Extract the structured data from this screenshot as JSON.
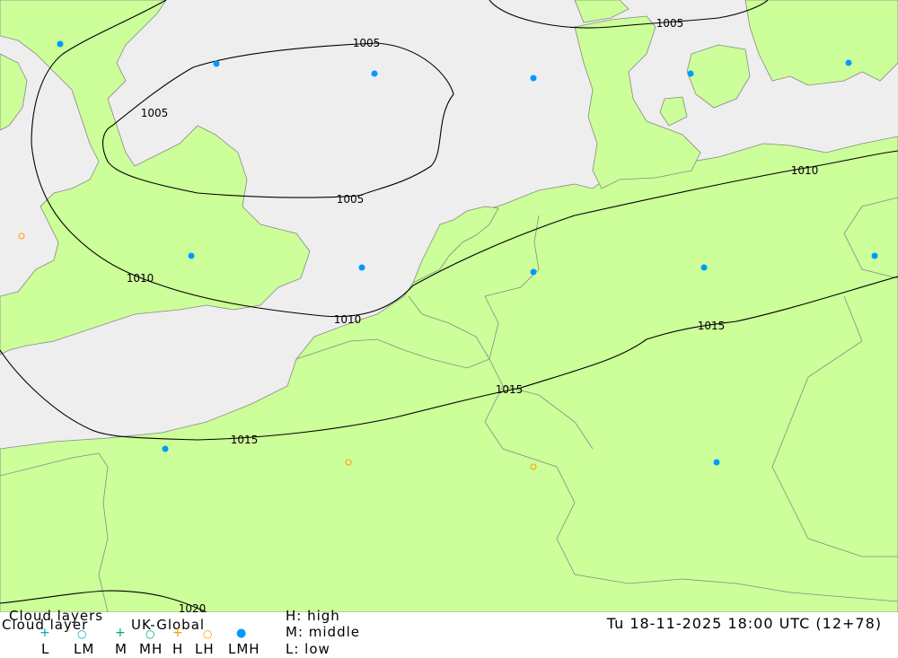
{
  "map": {
    "isobars": [
      {
        "label": "1005"
      },
      {
        "label": "1005"
      },
      {
        "label": "1005"
      },
      {
        "label": "1005"
      },
      {
        "label": "1010"
      },
      {
        "label": "1010"
      },
      {
        "label": "1010"
      },
      {
        "label": "1015"
      },
      {
        "label": "1015"
      },
      {
        "label": "1015"
      },
      {
        "label": "1020"
      }
    ],
    "colors": {
      "sea": "#eeeeee",
      "land": "#ccff99",
      "isobar": "#000000",
      "border": "#888888",
      "marker_filled": "#0099ff",
      "marker_ring": "#ff9900"
    }
  },
  "footer": {
    "title_line1": "Cloud layers",
    "title_line2": "Cloud layer",
    "model": "UK-Global",
    "legend_symbols": [
      {
        "label": "L",
        "icon": "plus",
        "color": "#00aacc"
      },
      {
        "label": "LM",
        "icon": "ring",
        "color": "#00aacc"
      },
      {
        "label": "M",
        "icon": "plus",
        "color": "#00aa66"
      },
      {
        "label": "MH",
        "icon": "ring",
        "color": "#00aa66"
      },
      {
        "label": "H",
        "icon": "plus",
        "color": "#ff9900"
      },
      {
        "label": "LH",
        "icon": "ring",
        "color": "#ff9900"
      },
      {
        "label": "LMH",
        "icon": "filled-dot",
        "color": "#0099ff"
      }
    ],
    "levels": {
      "high": "H: high",
      "middle": "M: middle",
      "low": "L: low"
    },
    "datetime": "Tu 18-11-2025 18:00 UTC (12+78)"
  }
}
